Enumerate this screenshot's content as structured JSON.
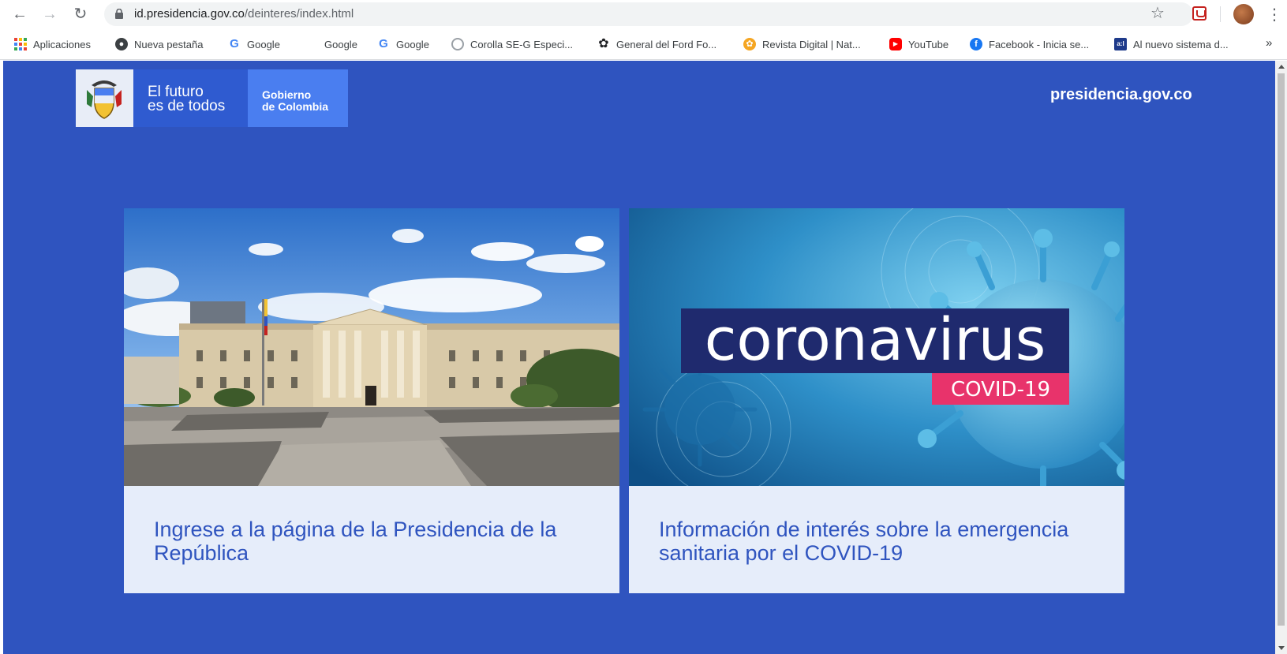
{
  "browser": {
    "url_host": "id.presidencia.gov.co",
    "url_path": "/deinteres/index.html"
  },
  "bookmarks": [
    {
      "label": "Aplicaciones",
      "icon": "apps-grid-icon"
    },
    {
      "label": "Nueva pestaña",
      "icon": "chrome-icon"
    },
    {
      "label": "Google",
      "icon": "google-icon"
    },
    {
      "label": "Google",
      "icon": "none"
    },
    {
      "label": "Google",
      "icon": "google-icon"
    },
    {
      "label": "Corolla SE-G Especi...",
      "icon": "toyota-icon"
    },
    {
      "label": "General del Ford Fo...",
      "icon": "ford-icon"
    },
    {
      "label": "Revista Digital | Nat...",
      "icon": "nat-icon"
    },
    {
      "label": "YouTube",
      "icon": "youtube-icon"
    },
    {
      "label": "Facebook - Inicia se...",
      "icon": "facebook-icon"
    },
    {
      "label": "Al nuevo sistema d...",
      "icon": "aa-icon"
    }
  ],
  "header": {
    "logo_line1": "El futuro",
    "logo_line2": "es de todos",
    "gov_line1": "Gobierno",
    "gov_line2": "de Colombia",
    "site_link": "presidencia.gov.co"
  },
  "cards": [
    {
      "text": "Ingrese a la página de la Presidencia de la República"
    },
    {
      "text": "Información de interés sobre la emergencia sanitaria por el COVID-19",
      "image_title": "coronavirus",
      "image_badge": "COVID-19"
    }
  ],
  "colors": {
    "page_bg": "#2f54bf",
    "card_bg": "#e6edfa",
    "badge": "#e8336b",
    "image_title_bg": "#1f2a6e"
  }
}
